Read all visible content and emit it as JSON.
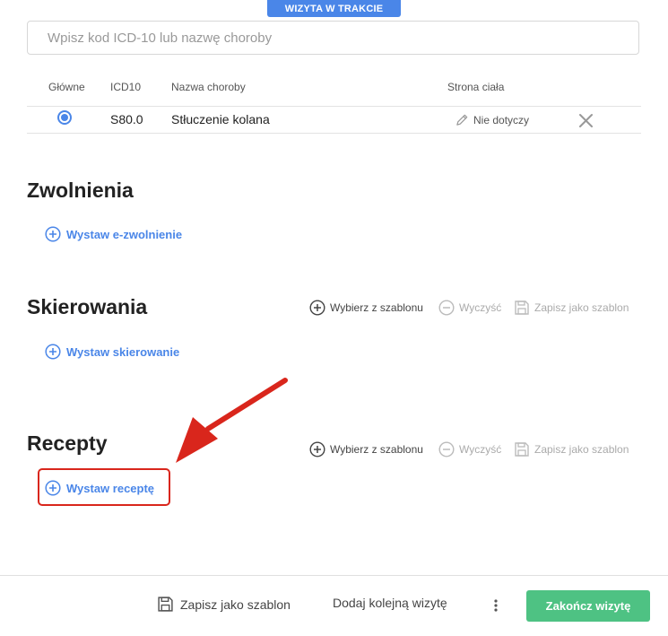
{
  "header": {
    "status": "WIZYTA W TRAKCIE"
  },
  "search": {
    "placeholder": "Wpisz kod ICD-10 lub nazwę choroby"
  },
  "diagnosis_table": {
    "columns": [
      "Główne",
      "ICD10",
      "Nazwa choroby",
      "Strona ciała"
    ],
    "rows": [
      {
        "main": true,
        "icd10": "S80.0",
        "name": "Stłuczenie kolana",
        "body_side": "Nie dotyczy"
      }
    ]
  },
  "sections": {
    "zwolnienia": {
      "title": "Zwolnienia",
      "add_label": "Wystaw e-zwolnienie"
    },
    "skierowania": {
      "title": "Skierowania",
      "add_label": "Wystaw skierowanie",
      "tools": {
        "template": "Wybierz z szablonu",
        "clear": "Wyczyść",
        "save": "Zapisz jako szablon"
      }
    },
    "recepty": {
      "title": "Recepty",
      "add_label": "Wystaw receptę",
      "tools": {
        "template": "Wybierz z szablonu",
        "clear": "Wyczyść",
        "save": "Zapisz jako szablon"
      }
    }
  },
  "footer": {
    "save_template": "Zapisz jako szablon",
    "add_visit": "Dodaj kolejną wizytę",
    "finish": "Zakończ wizytę"
  },
  "colors": {
    "accent": "#4a86e8",
    "success": "#4ec283",
    "annotation": "#d9261c"
  }
}
